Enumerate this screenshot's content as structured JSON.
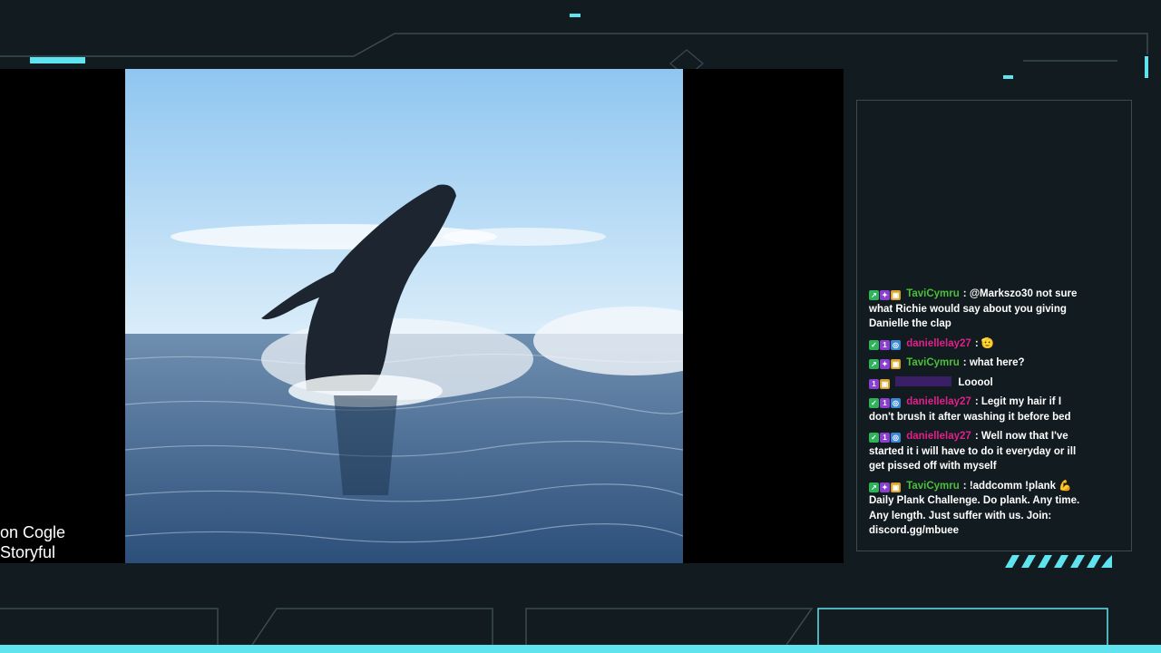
{
  "colors": {
    "background": "#121b20",
    "accent": "#5fe3ee",
    "frame_line": "#3b4a52"
  },
  "video": {
    "credit_line1": "on Cogle",
    "credit_line2": "Storyful"
  },
  "chat": {
    "messages": [
      {
        "badges": [
          "green-arrow",
          "gift",
          "gold-badge"
        ],
        "user": "TaviCymru",
        "user_color": "#4cbf3a",
        "text": "@Markszo30 not sure what Richie would say about you giving Danielle the clap"
      },
      {
        "badges": [
          "green-check",
          "sub-1",
          "blue-goggles"
        ],
        "user": "daniellelay27",
        "user_color": "#e0208a",
        "text": "🫡"
      },
      {
        "badges": [
          "green-arrow",
          "gift",
          "gold-badge"
        ],
        "user": "TaviCymru",
        "user_color": "#4cbf3a",
        "text": "what here?"
      },
      {
        "badges": [
          "sub-1",
          "gold-badge"
        ],
        "user": "",
        "user_color": "#6a2bb5",
        "text": "Looool"
      },
      {
        "badges": [
          "green-check",
          "sub-1",
          "blue-goggles"
        ],
        "user": "daniellelay27",
        "user_color": "#e0208a",
        "text": "Legit my hair if I don't brush it after washing it before bed"
      },
      {
        "badges": [
          "green-check",
          "sub-1",
          "blue-goggles"
        ],
        "user": "daniellelay27",
        "user_color": "#e0208a",
        "text": "Well now that I've started it i will have to do it everyday or ill get pissed off with myself"
      },
      {
        "badges": [
          "green-arrow",
          "gift",
          "gold-badge"
        ],
        "user": "TaviCymru",
        "user_color": "#4cbf3a",
        "text": "!addcomm !plank 💪 Daily Plank Challenge. Do plank. Any time. Any length. Just suffer with us. Join: discord.gg/mbuee"
      }
    ]
  }
}
